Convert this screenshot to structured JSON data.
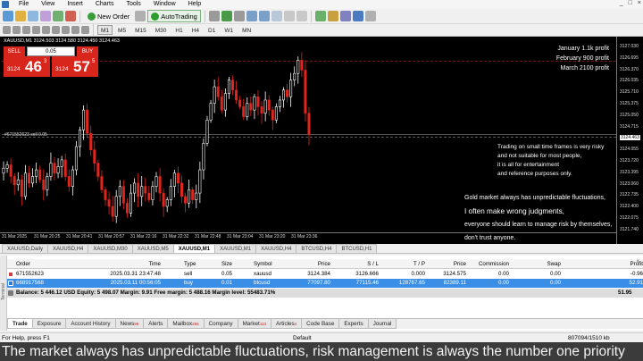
{
  "menu": {
    "items": [
      "File",
      "View",
      "Insert",
      "Charts",
      "Tools",
      "Window",
      "Help"
    ],
    "window_controls": [
      "_",
      "□",
      "×"
    ]
  },
  "toolbar": {
    "new_order": "New Order",
    "autotrading": "AutoTrading"
  },
  "timeframes": [
    "M1",
    "M5",
    "M15",
    "M30",
    "H1",
    "H4",
    "D1",
    "W1",
    "MN"
  ],
  "active_timeframe": "M1",
  "chart": {
    "symbol_info": "XAUUSD,M1  3124.503 3124.580 3124.450 3124.463",
    "one_click": {
      "sell_label": "SELL",
      "buy_label": "BUY",
      "lot": "0.05",
      "bid_prefix": "3124",
      "bid_big": "46",
      "bid_sup": "3",
      "ask_prefix": "3124",
      "ask_big": "57",
      "ask_sup": "5"
    },
    "profit_notes": [
      "January 1.1k profit",
      "February 900 profit",
      "March 2100 profit"
    ],
    "order_line_label": "#671552623 sell 0.05",
    "notes_risk": [
      "Trading on small time frames is very risky",
      "and not suitable for most people,",
      "it is all for entertainment",
      "and reference purposes only."
    ],
    "notes_gold": [
      "Gold market always has unpredictable fluctuations,",
      "I often make wrong judgments,",
      "everyone should learn to manage risk by themselves,",
      "don't trust anyone."
    ],
    "y_labels": [
      "3127.030",
      "3126.695",
      "3126.370",
      "3126.035",
      "3125.710",
      "3125.375",
      "3125.050",
      "3124.715",
      "3124.463",
      "3124.055",
      "3123.720",
      "3123.395",
      "3123.060",
      "3122.735",
      "3122.400",
      "3122.075",
      "3121.740"
    ],
    "current_price_label": "3124.463",
    "x_labels": [
      "31 Mar 2025",
      "31 Mar 20:25",
      "31 Mar 20:41",
      "31 Mar 20:57",
      "31 Mar 22:16",
      "31 Mar 22:32",
      "31 Mar 22:48",
      "31 Mar 23:04",
      "31 Mar 23:20",
      "31 Mar 23:36"
    ],
    "bull_color": "#ffffff",
    "bear_color": "#e0261c",
    "chart_data": {
      "type": "candlestick",
      "symbol": "XAUUSD",
      "timeframe": "M1",
      "ylim": [
        3121.6,
        3127.3
      ],
      "close_trace": [
        3123.45,
        3123.55,
        3123.2,
        3122.95,
        3123.1,
        3122.6,
        3123.3,
        3123.0,
        3123.2,
        3123.4,
        3123.1,
        3122.8,
        3123.2,
        3123.6,
        3123.3,
        3123.5,
        3123.7,
        3123.2,
        3122.9,
        3123.4,
        3124.1,
        3124.6,
        3125.2,
        3124.5,
        3124.0,
        3123.6,
        3123.2,
        3122.8,
        3122.5,
        3122.3,
        3122.0,
        3122.6,
        3122.9,
        3122.4,
        3122.1,
        3122.7,
        3123.0,
        3122.6,
        3122.9,
        3122.7,
        3122.5,
        3122.9,
        3123.2,
        3122.7,
        3122.3,
        3122.5,
        3122.9,
        3123.3,
        3123.0,
        3122.6,
        3122.4,
        3122.8,
        3122.5,
        3122.7,
        3123.4,
        3124.2,
        3124.9,
        3125.4,
        3125.9,
        3125.6,
        3125.2,
        3125.7,
        3126.1,
        3125.8,
        3125.5,
        3125.3,
        3125.0,
        3125.4,
        3125.2,
        3125.6,
        3125.3,
        3125.1,
        3125.5,
        3125.2,
        3124.9,
        3125.3,
        3125.5,
        3125.8,
        3125.6,
        3126.1,
        3126.3,
        3126.7,
        3126.4,
        3125.1,
        3124.46
      ]
    }
  },
  "symbol_tabs": [
    "XAUUSD,Daily",
    "XAUUSD,H4",
    "XAUUSD,M30",
    "XAUUSD,M5",
    "XAUUSD,M1",
    "XAUUSD,M1",
    "XAUUSD,H4",
    "BTCUSD,H4",
    "BTCUSD,H1"
  ],
  "active_symbol_tab": 4,
  "terminal": {
    "side_label": "Terminal",
    "headers": [
      "Order",
      "Time",
      "Type",
      "Size",
      "Symbol",
      "Price",
      "S / L",
      "T / P",
      "Price",
      "Commission",
      "Swap",
      "Profit"
    ],
    "rows": [
      [
        "671552623",
        "2025.03.31 23:47:48",
        "sell",
        "0.05",
        "xauusd",
        "3124.384",
        "3126.666",
        "0.000",
        "3124.575",
        "0.00",
        "0.00",
        "-0.96"
      ],
      [
        "668917568",
        "2025.03.11 00:56:05",
        "buy",
        "0.01",
        "btcusd",
        "77097.80",
        "77115.46",
        "128767.65",
        "82389.11",
        "0.00",
        "0.00",
        "52.91"
      ]
    ],
    "balance_line": "Balance: 5 446.12 USD  Equity: 5 498.07  Margin: 9.91  Free margin: 5 488.16  Margin level: 55483.71%",
    "balance_profit": "51.95"
  },
  "bottom_tabs": [
    {
      "label": "Trade",
      "badge": ""
    },
    {
      "label": "Exposure",
      "badge": ""
    },
    {
      "label": "Account History",
      "badge": ""
    },
    {
      "label": "News",
      "badge": "99"
    },
    {
      "label": "Alerts",
      "badge": ""
    },
    {
      "label": "Mailbox",
      "badge": "256"
    },
    {
      "label": "Company",
      "badge": ""
    },
    {
      "label": "Market",
      "badge": "113"
    },
    {
      "label": "Articles",
      "badge": "4"
    },
    {
      "label": "Code Base",
      "badge": ""
    },
    {
      "label": "Experts",
      "badge": ""
    },
    {
      "label": "Journal",
      "badge": ""
    }
  ],
  "status": {
    "help": "For Help, press F1",
    "profile": "Default",
    "traffic": "807094/1510 kb"
  },
  "caption": "The market always has unpredictable fluctuations, risk management is always the number one priority"
}
